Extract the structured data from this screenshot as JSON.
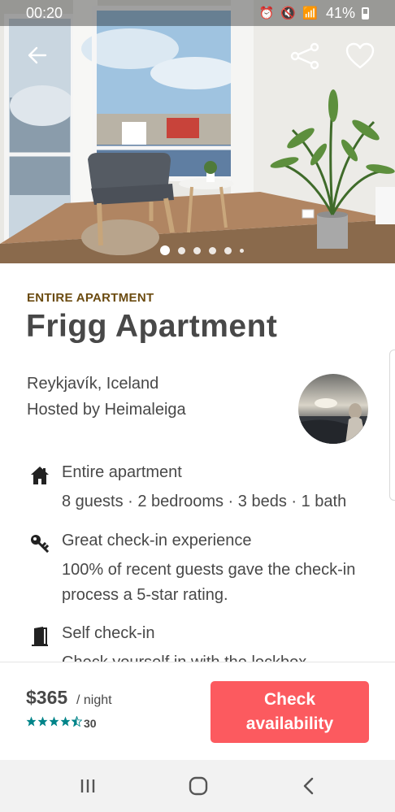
{
  "status_bar": {
    "time": "00:20",
    "icons": [
      "alarm-icon",
      "mute-icon",
      "wifi-icon",
      "signal-icon"
    ],
    "battery": "41%"
  },
  "hero": {
    "photo": "living room with armchair, coffee table and potted palm by tall windows",
    "pages": 6,
    "active_page": 1
  },
  "listing": {
    "kind": "ENTIRE APARTMENT",
    "title": "Frigg Apartment",
    "location": "Reykjavík, Iceland",
    "host": "Hosted by Heimaleiga"
  },
  "features": [
    {
      "icon": "house-icon",
      "title": "Entire apartment",
      "desc": "8 guests · 2 bedrooms · 3 beds · 1 bath"
    },
    {
      "icon": "key-icon",
      "title": "Great check-in experience",
      "desc": "100% of recent guests gave the check-in process a 5-star rating."
    },
    {
      "icon": "door-icon",
      "title": "Self check-in",
      "desc": "Check yourself in with the lockbox."
    }
  ],
  "booking": {
    "price": "$365",
    "per": "/ night",
    "rating": 4.5,
    "reviews": "30",
    "button": "Check availability"
  },
  "colors": {
    "accent": "#fc5a5f",
    "stars": "#008489",
    "kind_label": "#6b4b10",
    "text": "#484848"
  }
}
